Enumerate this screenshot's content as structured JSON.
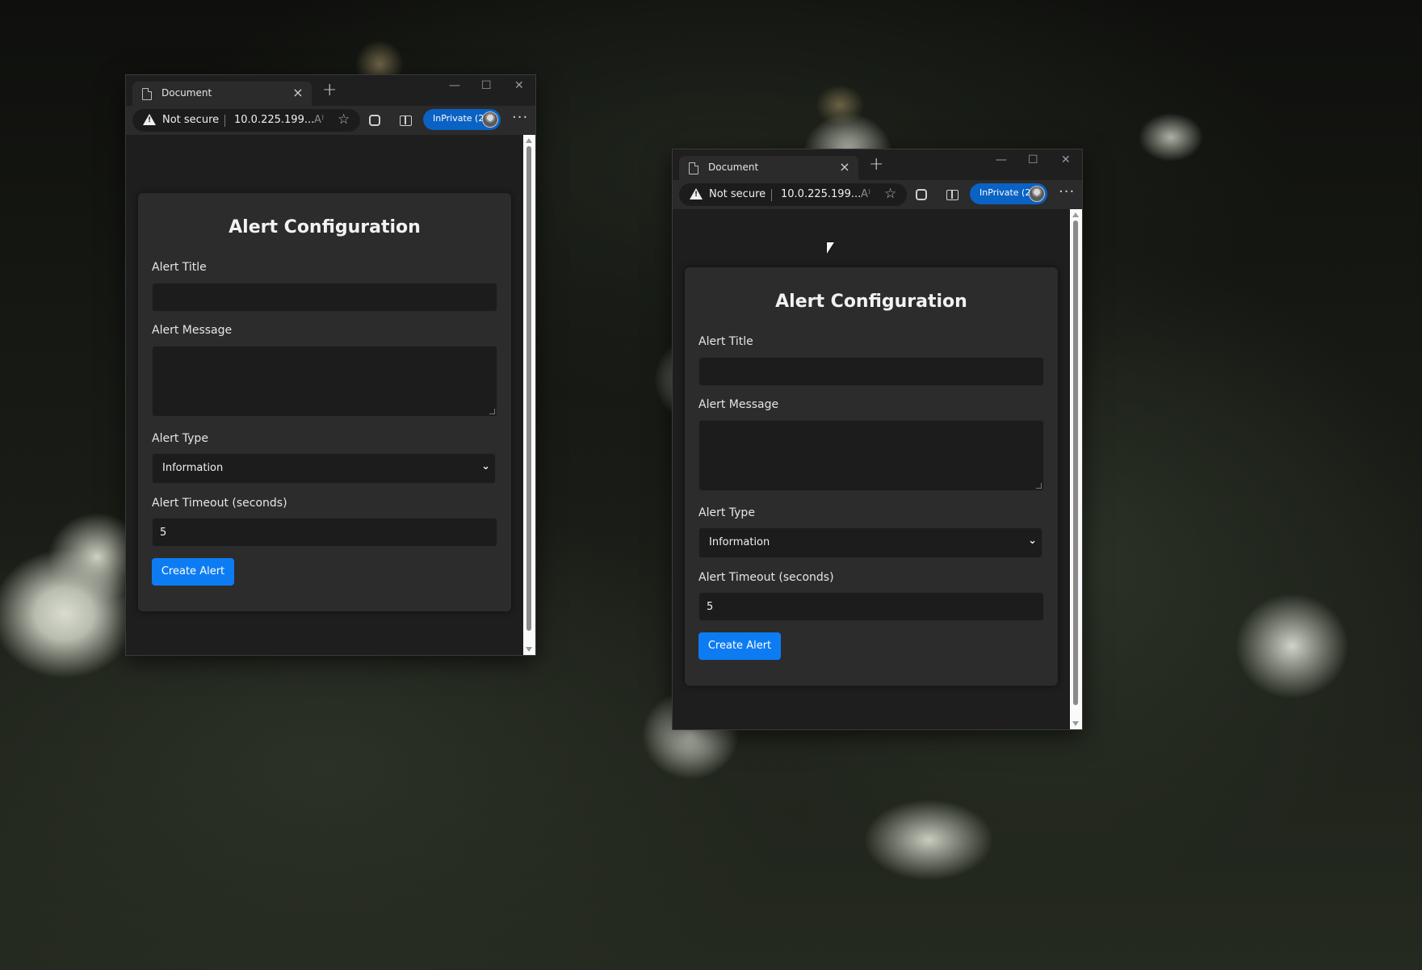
{
  "browser": {
    "tab_title": "Document",
    "tab_close": "×",
    "new_tab": "+",
    "minimize": "—",
    "maximize": "☐",
    "close": "✕",
    "security_label": "Not secure",
    "url": "10.0.225.199...",
    "read_aloud": "A⁾",
    "favorite": "☆",
    "inprivate_label": "InPrivate (2)",
    "more": "···",
    "icons": [
      "document-icon",
      "warning-icon",
      "read-aloud-icon",
      "favorite-icon",
      "extensions-icon",
      "split-screen-icon",
      "avatar-icon"
    ]
  },
  "form": {
    "heading": "Alert Configuration",
    "title_label": "Alert Title",
    "title_value": "",
    "message_label": "Alert Message",
    "message_value": "",
    "type_label": "Alert Type",
    "type_value": "Information",
    "type_chevron": "⌄",
    "timeout_label": "Alert Timeout (seconds)",
    "timeout_value": "5",
    "submit_label": "Create Alert"
  },
  "colors": {
    "accent_button": "#0d7cf2",
    "inprivate_badge": "#0a62c4",
    "card_bg": "#2c2c2c",
    "page_bg": "#1e1e1e"
  }
}
